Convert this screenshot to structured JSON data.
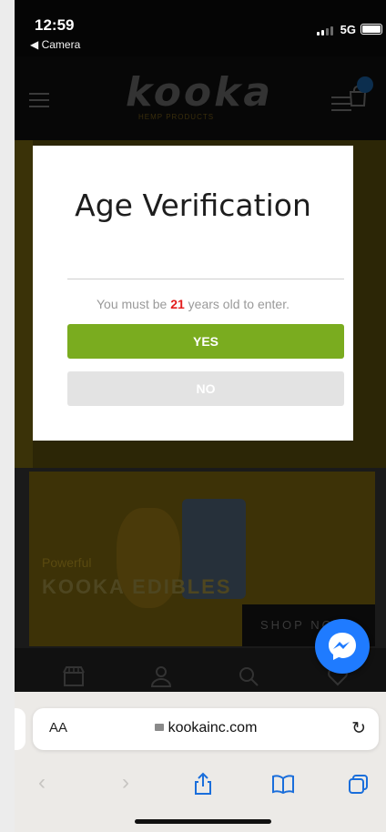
{
  "status_bar": {
    "time": "12:59",
    "back_app": "◀ Camera",
    "network": "5G"
  },
  "site": {
    "logo": "kooka",
    "logo_sub": "HEMP PRODUCTS",
    "banner_small": "Powerful",
    "banner_big": "KOOKA EDIBLES",
    "shop_now": "SHOP NOW"
  },
  "modal": {
    "title": "Age Verification",
    "message_before": "You must be ",
    "age": "21",
    "message_after": " years old to enter.",
    "yes_label": "YES",
    "no_label": "NO"
  },
  "browser": {
    "text_size_label": "AA",
    "url": "kookainc.com"
  },
  "colors": {
    "yes_button": "#7aac1f",
    "no_button": "#e3e3e3",
    "age_highlight": "#e31d1d",
    "messenger": "#1f7bff",
    "safari_active": "#1a6edb"
  }
}
